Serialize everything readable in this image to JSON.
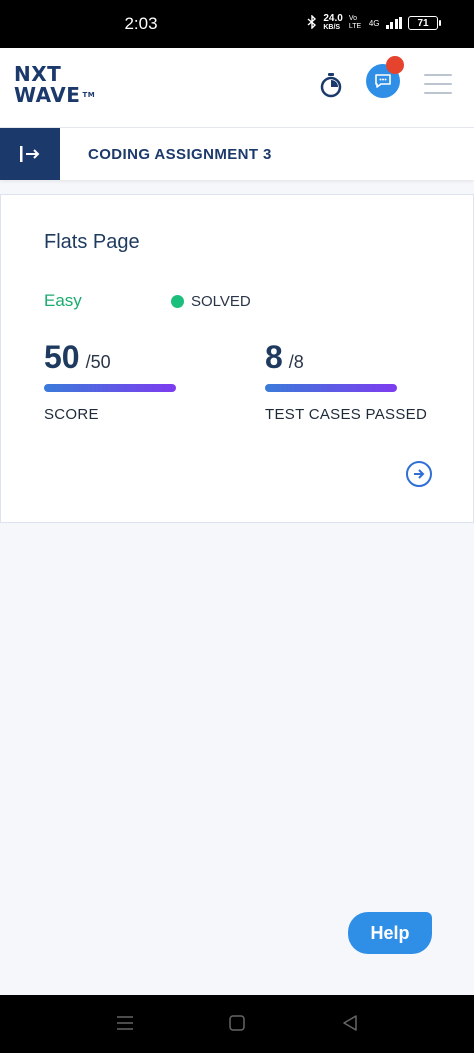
{
  "status_bar": {
    "time": "2:03",
    "net_speed": "24.0",
    "net_unit": "KB/S",
    "volte": "Vo LTE",
    "network": "4G",
    "battery": "71"
  },
  "header": {
    "logo_line1": "NXT",
    "logo_line2": "WAVE",
    "logo_tm": "TM"
  },
  "subheader": {
    "title": "CODING ASSIGNMENT 3"
  },
  "card": {
    "name": "Flats Page",
    "difficulty": "Easy",
    "status": "SOLVED",
    "score": {
      "value": "50",
      "total": "/50",
      "label": "SCORE",
      "fill": 1.0
    },
    "tests": {
      "value": "8",
      "total": "/8",
      "label": "TEST CASES PASSED",
      "fill": 1.0
    }
  },
  "help_label": "Help",
  "colors": {
    "brand_navy": "#1b3a6b",
    "accent_blue": "#2f8fe6",
    "easy_green": "#1bab6e",
    "solved_dot": "#1bbf7c",
    "notification_red": "#e5432e"
  }
}
